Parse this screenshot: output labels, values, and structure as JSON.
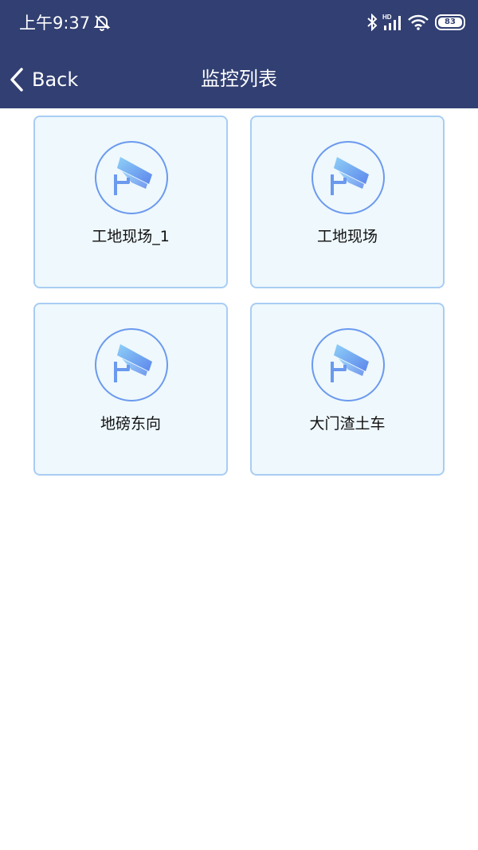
{
  "status_bar": {
    "time": "上午9:37",
    "battery": "83",
    "icons": [
      "alarm-off-icon",
      "bluetooth-icon",
      "hd-signal-icon",
      "wifi-icon",
      "battery-icon"
    ]
  },
  "nav": {
    "back_label": "Back",
    "title": "监控列表"
  },
  "colors": {
    "header_bg": "#313f72",
    "card_bg": "#eef8fd",
    "card_border": "#a9cdf3",
    "icon_blue": "#6b99ee"
  },
  "monitors": [
    {
      "label": "工地现场_1",
      "icon": "camera-icon"
    },
    {
      "label": "工地现场",
      "icon": "camera-icon"
    },
    {
      "label": "地磅东向",
      "icon": "camera-icon"
    },
    {
      "label": "大门渣土车",
      "icon": "camera-icon"
    }
  ]
}
